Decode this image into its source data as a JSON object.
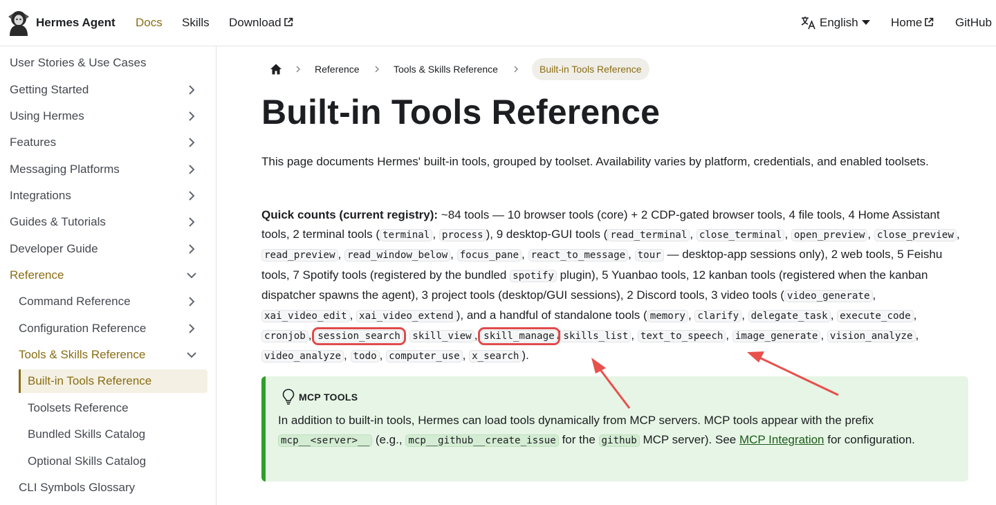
{
  "navbar": {
    "brand": "Hermes Agent",
    "links": [
      {
        "label": "Docs",
        "active": true
      },
      {
        "label": "Skills"
      },
      {
        "label": "Download"
      }
    ],
    "language": "English",
    "home": "Home",
    "github": "GitHub"
  },
  "sidebar": {
    "items": [
      {
        "label": "User Stories & Use Cases",
        "chevron": "none"
      },
      {
        "label": "Getting Started",
        "chevron": "right"
      },
      {
        "label": "Using Hermes",
        "chevron": "right"
      },
      {
        "label": "Features",
        "chevron": "right"
      },
      {
        "label": "Messaging Platforms",
        "chevron": "right"
      },
      {
        "label": "Integrations",
        "chevron": "right"
      },
      {
        "label": "Guides & Tutorials",
        "chevron": "right"
      },
      {
        "label": "Developer Guide",
        "chevron": "right"
      },
      {
        "label": "Reference",
        "chevron": "down"
      },
      {
        "label": "Command Reference",
        "chevron": "right"
      },
      {
        "label": "Configuration Reference",
        "chevron": "right"
      },
      {
        "label": "Tools & Skills Reference",
        "chevron": "down"
      },
      {
        "label": "Built-in Tools Reference",
        "chevron": "none"
      },
      {
        "label": "Toolsets Reference",
        "chevron": "none"
      },
      {
        "label": "Bundled Skills Catalog",
        "chevron": "none"
      },
      {
        "label": "Optional Skills Catalog",
        "chevron": "none"
      },
      {
        "label": "CLI Symbols Glossary",
        "chevron": "none"
      }
    ]
  },
  "breadcrumbs": [
    "Reference",
    "Tools & Skills Reference",
    "Built-in Tools Reference"
  ],
  "page": {
    "title": "Built-in Tools Reference",
    "intro": "This page documents Hermes' built-in tools, grouped by toolset. Availability varies by platform, credentials, and enabled toolsets.",
    "quick_label": "Quick counts (current registry):",
    "t1": " ~84 tools — 10 browser tools (core) + 2 CDP-gated browser tools, 4 file tools, 4 Home Assistant tools, 2 terminal tools (",
    "c_terminal": "terminal",
    "sep_comma": ", ",
    "c_process": "process",
    "t2": "), 9 desktop-GUI tools (",
    "c_read_terminal": "read_terminal",
    "c_close_terminal": "close_terminal",
    "c_open_preview": "open_preview",
    "c_close_preview": "close_preview",
    "c_read_preview": "read_preview",
    "c_read_window_below": "read_window_below",
    "c_focus_pane": "focus_pane",
    "c_react_to_message": "react_to_message",
    "c_tour": "tour",
    "t3": " — desktop-app sessions only), 2 web tools, 5 Feishu tools, 7 Spotify tools (registered by the bundled ",
    "c_spotify": "spotify",
    "t4": " plugin), 5 Yuanbao tools, 12 kanban tools (registered when the kanban dispatcher spawns the agent), 3 project tools (desktop/GUI sessions), 2 Discord tools, 3 video tools (",
    "c_video_generate": "video_generate",
    "c_xai_video_edit": "xai_video_edit",
    "c_xai_video_extend": "xai_video_extend",
    "t5": "), and a handful of standalone tools (",
    "c_memory": "memory",
    "c_clarify": "clarify",
    "c_delegate_task": "delegate_task",
    "c_execute_code": "execute_code",
    "c_cronjob": "cronjob",
    "c_session_search": "session_search",
    "c_skill_view": "skill_view",
    "c_skill_manage": "skill_manage",
    "sep_slash": "/",
    "c_skills_list": "skills_list",
    "c_text_to_speech": "text_to_speech",
    "c_image_generate": "image_generate",
    "c_vision_analyze": "vision_analyze",
    "c_video_analyze": "video_analyze",
    "c_todo": "todo",
    "c_computer_use": "computer_use",
    "c_x_search": "x_search",
    "t6": ")."
  },
  "admonition": {
    "title": "MCP TOOLS",
    "a1": "In addition to built-in tools, Hermes can load tools dynamically from MCP servers. MCP tools appear with the prefix ",
    "c_prefix": "mcp__<server>__",
    "a2": " (e.g., ",
    "c_example": "mcp__github__create_issue",
    "a3": " for the ",
    "c_github": "github",
    "a4": " MCP server). See ",
    "link": "MCP Integration",
    "a5": " for configuration."
  },
  "colors": {
    "accent": "#8a6d14",
    "highlight": "#e04a4a",
    "admonition_bg": "#e6f5e5",
    "admonition_border": "#2f9e2a"
  }
}
